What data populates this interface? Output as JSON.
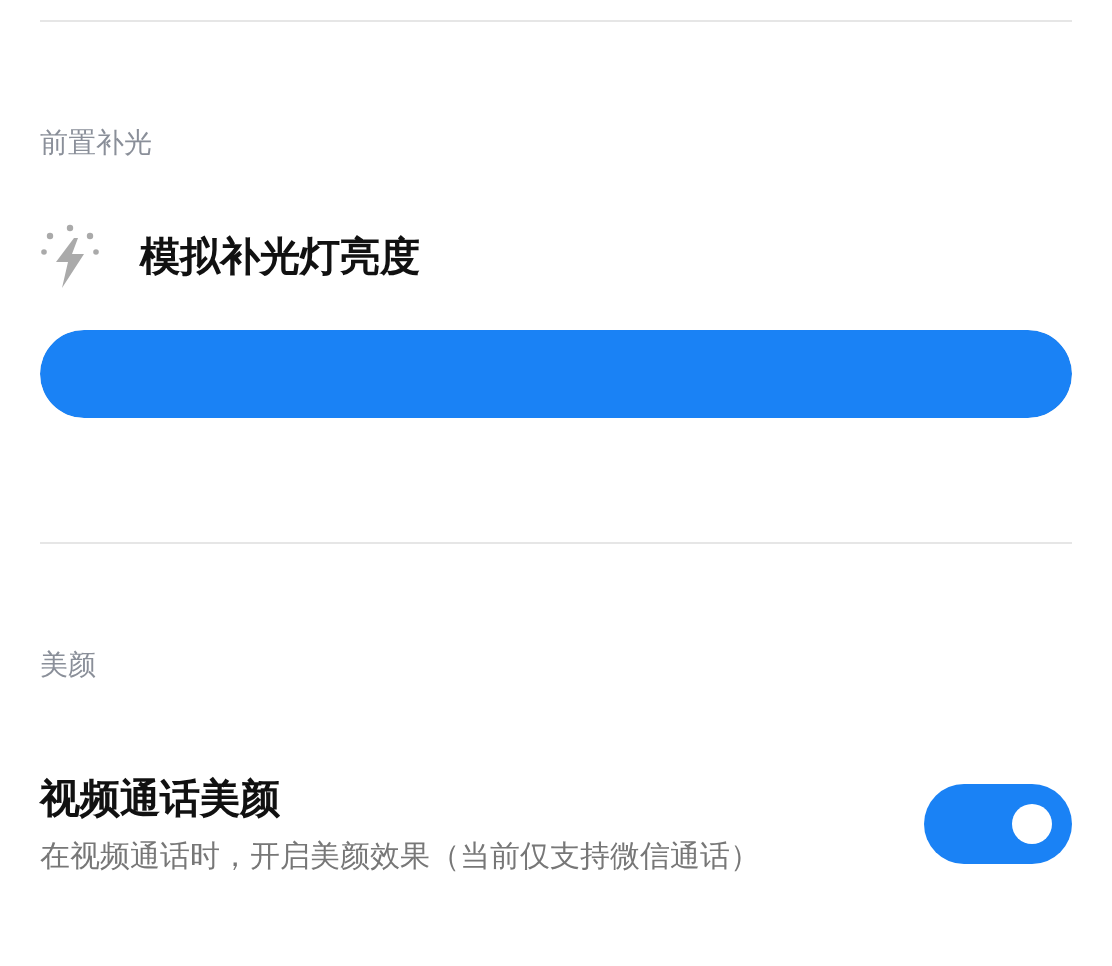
{
  "sections": [
    {
      "header": "前置补光",
      "items": [
        {
          "kind": "slider",
          "label": "模拟补光灯亮度",
          "level": 1
        }
      ]
    },
    {
      "header": "美颜",
      "items": [
        {
          "kind": "toggle",
          "label": "视频通话美颜",
          "description": "在视频通话时，开启美颜效果（当前仅支持微信通话）",
          "on": true
        }
      ]
    }
  ]
}
